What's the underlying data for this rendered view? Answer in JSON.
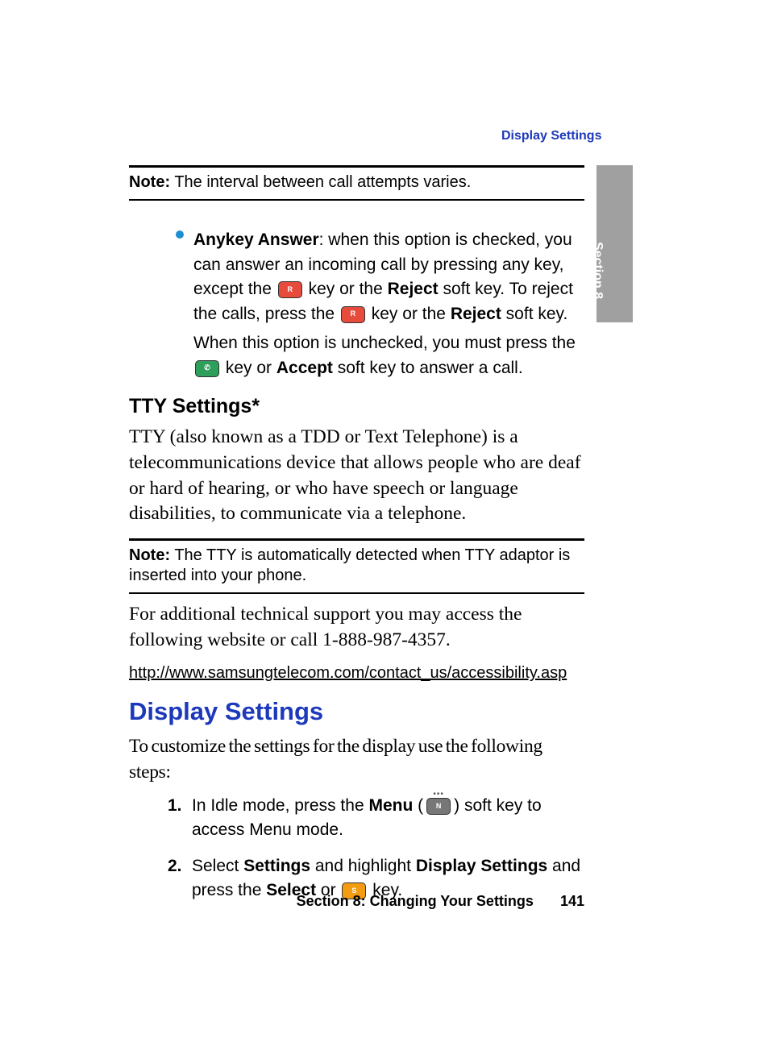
{
  "header": {
    "running_head": "Display Settings"
  },
  "sidebar": {
    "tab_label": "Section 8"
  },
  "note1": {
    "label": "Note:",
    "text": "The interval between call attempts varies."
  },
  "anykey": {
    "title": "Anykey Answer",
    "p1_a": ": when this option is checked, you can answer an incoming call by pressing any key, except the ",
    "p1_b": " key or the ",
    "reject": "Reject",
    "p1_c": " soft key. To reject the calls, press the ",
    "p1_d": " key or the ",
    "p1_e": " soft key.",
    "p2_a": "When this option is unchecked, you must press the ",
    "p2_b": " key or ",
    "accept": "Accept",
    "p2_c": " soft key to answer a call."
  },
  "tty": {
    "heading": "TTY Settings*",
    "body": "TTY (also known as a TDD or Text Telephone) is a telecommunications device that allows people who are deaf or hard of hearing, or who have speech or language disabilities, to communicate via a telephone."
  },
  "note2": {
    "label": "Note:",
    "text": "The TTY is automatically detected when TTY adaptor is inserted into your phone."
  },
  "support": {
    "body": "For additional technical support you may access the following website or call 1-888-987-4357.",
    "url": "http://www.samsungtelecom.com/contact_us/accessibility.asp"
  },
  "display": {
    "heading": "Display Settings",
    "intro": "To customize the settings for the display use the following steps:",
    "steps": {
      "s1_num": "1.",
      "s1_a": "In Idle mode, press the ",
      "s1_menu": "Menu",
      "s1_b": " (",
      "s1_c": ") soft key to access Menu mode.",
      "s2_num": "2.",
      "s2_a": "Select ",
      "s2_settings": "Settings",
      "s2_b": " and highlight ",
      "s2_ds": "Display Settings",
      "s2_c": " and press the ",
      "s2_select": "Select",
      "s2_d": " or ",
      "s2_e": " key."
    }
  },
  "footer": {
    "section": "Section 8: Changing Your Settings",
    "page": "141"
  },
  "icons": {
    "red_key": "R",
    "green_key": "✆",
    "gray_key": "N",
    "orange_key": "S"
  }
}
